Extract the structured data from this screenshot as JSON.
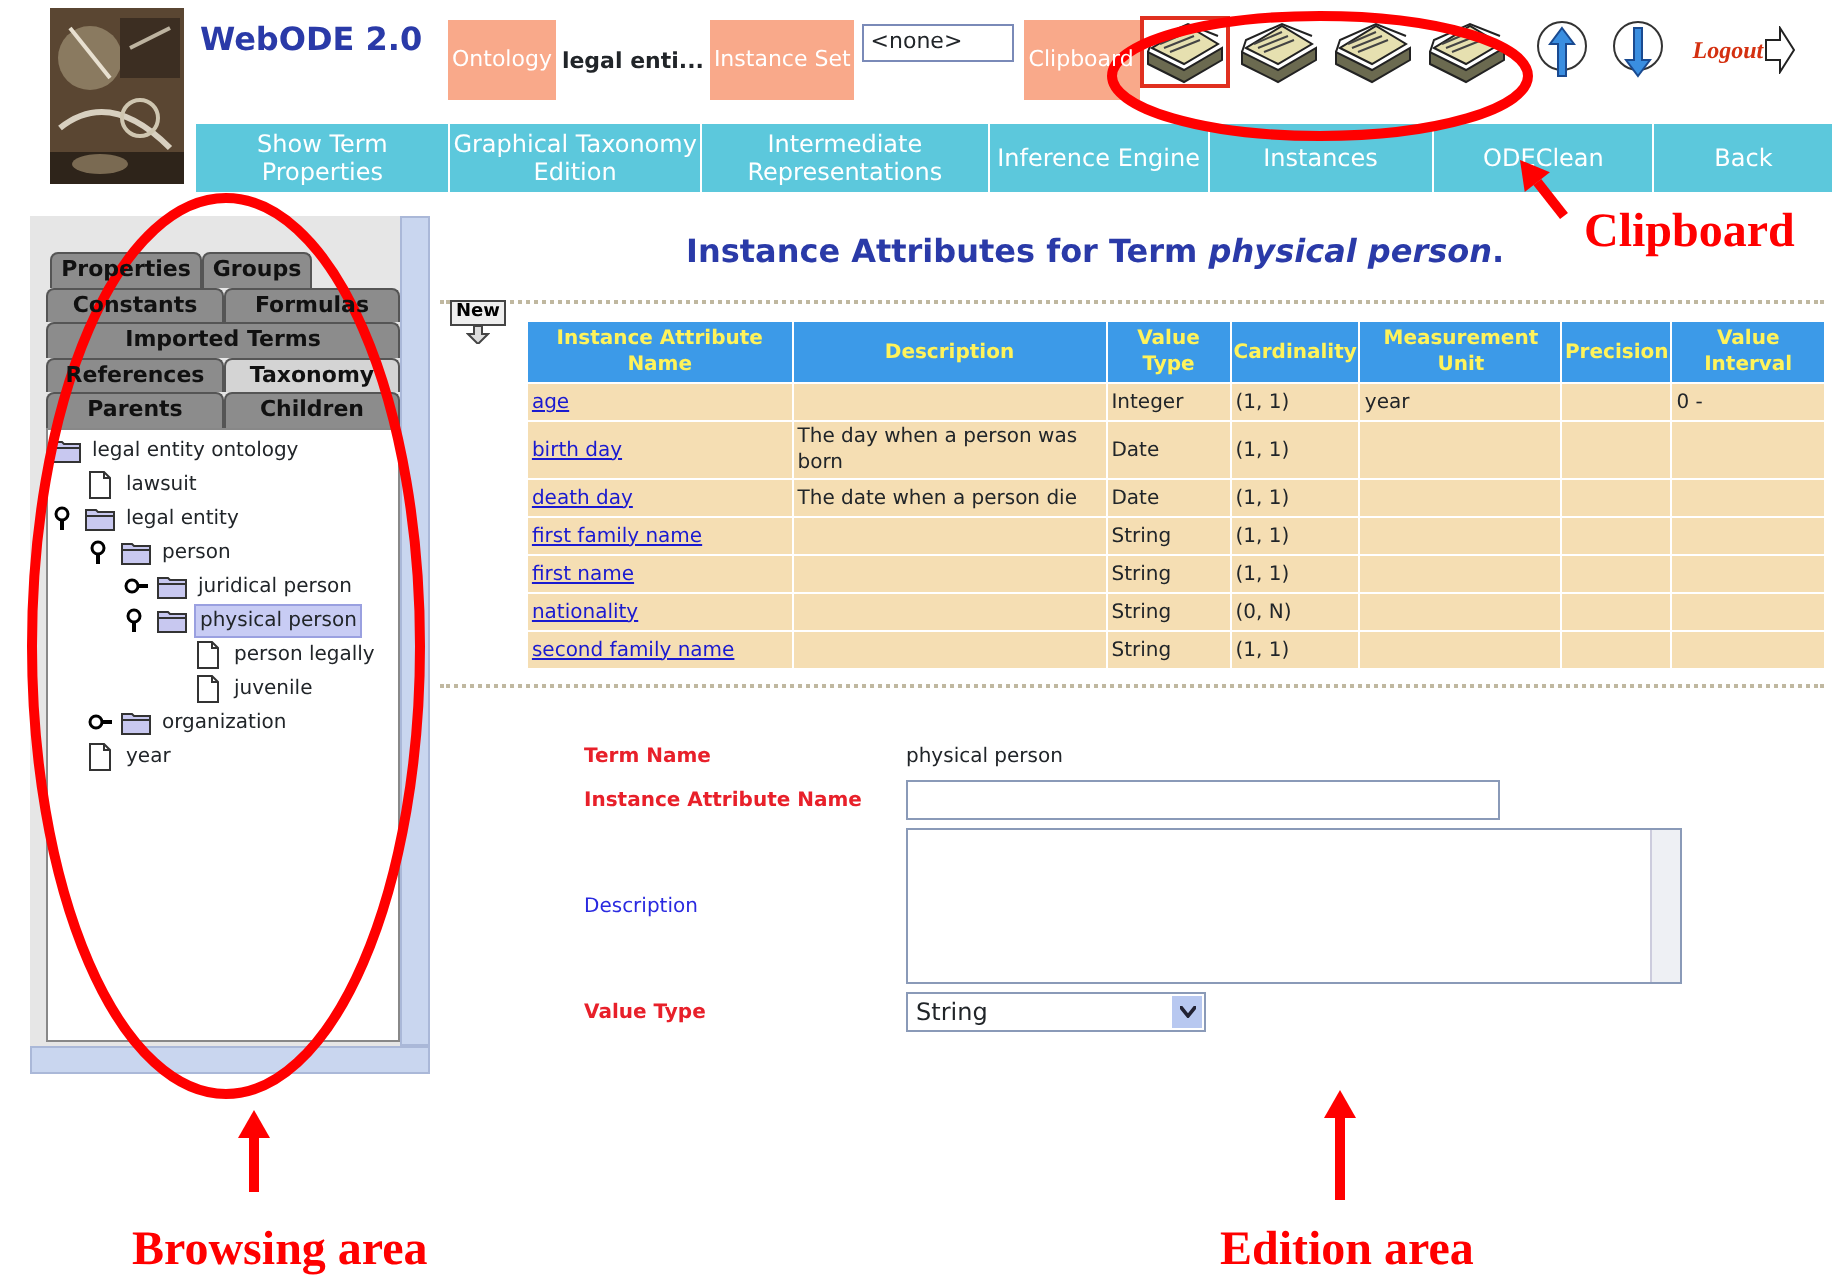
{
  "app": {
    "title": "WebODE 2.0"
  },
  "toolbar": {
    "ontology_label": "Ontology",
    "ontology_value": "legal enti...",
    "instance_set_label": "Instance Set",
    "instance_set_value": "<none>",
    "clipboard_label": "Clipboard",
    "logout": "Logout",
    "clipboard_slots": [
      {
        "selected": true
      },
      {
        "selected": false
      },
      {
        "selected": false
      },
      {
        "selected": false
      }
    ]
  },
  "nav": [
    {
      "label": "Show Term Properties"
    },
    {
      "label": "Graphical Taxonomy Edition"
    },
    {
      "label": "Intermediate Representations"
    },
    {
      "label": "Inference Engine"
    },
    {
      "label": "Instances"
    },
    {
      "label": "ODEClean"
    },
    {
      "label": "Back"
    }
  ],
  "browser": {
    "tab_rows": [
      [
        {
          "label": "Properties",
          "selected": false
        },
        {
          "label": "Groups",
          "selected": false
        }
      ],
      [
        {
          "label": "Constants",
          "selected": false
        },
        {
          "label": "Formulas",
          "selected": false
        }
      ],
      [
        {
          "label": "Imported Terms",
          "selected": false
        }
      ],
      [
        {
          "label": "References",
          "selected": false
        },
        {
          "label": "Taxonomy",
          "selected": true
        }
      ],
      [
        {
          "label": "Parents",
          "selected": false
        },
        {
          "label": "Children",
          "selected": false
        }
      ]
    ],
    "tree": [
      {
        "label": "legal entity ontology",
        "kind": "folder",
        "selected": false,
        "children": [
          {
            "label": "lawsuit",
            "kind": "doc",
            "selected": false
          },
          {
            "label": "legal entity",
            "kind": "folder",
            "expanded": true,
            "selected": false,
            "children": [
              {
                "label": "person",
                "kind": "folder",
                "expanded": true,
                "selected": false,
                "children": [
                  {
                    "label": "juridical person",
                    "kind": "folder",
                    "expanded": false,
                    "selected": false
                  },
                  {
                    "label": "physical person",
                    "kind": "folder",
                    "expanded": true,
                    "selected": true,
                    "children": [
                      {
                        "label": "person legally",
                        "kind": "doc",
                        "selected": false
                      },
                      {
                        "label": "juvenile",
                        "kind": "doc",
                        "selected": false
                      }
                    ]
                  }
                ]
              },
              {
                "label": "organization",
                "kind": "folder",
                "expanded": false,
                "selected": false
              }
            ]
          },
          {
            "label": "year",
            "kind": "doc",
            "selected": false
          }
        ]
      }
    ]
  },
  "heading": "Instance Attributes for Term *physical person*.",
  "new_button": "New",
  "table": {
    "columns": [
      "Instance Attribute Name",
      "Description",
      "Value Type",
      "Cardinality",
      "Measurement Unit",
      "Precision",
      "Value Interval"
    ],
    "rows": [
      [
        "age",
        "",
        "Integer",
        "(1, 1)",
        "year",
        "",
        "0 -"
      ],
      [
        "birth day",
        "The day when a person was born",
        "Date",
        "(1, 1)",
        "",
        "",
        ""
      ],
      [
        "death day",
        "The date when a person die",
        "Date",
        "(1, 1)",
        "",
        "",
        ""
      ],
      [
        "first family name",
        "",
        "String",
        "(1, 1)",
        "",
        "",
        ""
      ],
      [
        "first name",
        "",
        "String",
        "(1, 1)",
        "",
        "",
        ""
      ],
      [
        "nationality",
        "",
        "String",
        "(0, N)",
        "",
        "",
        ""
      ],
      [
        "second family name",
        "",
        "String",
        "(1, 1)",
        "",
        "",
        ""
      ]
    ]
  },
  "form": {
    "fields": [
      {
        "label": "Term Name",
        "kind": "text",
        "required": true,
        "value": "physical person"
      },
      {
        "label": "Instance Attribute Name",
        "kind": "input",
        "required": true
      },
      {
        "label": "Description",
        "kind": "textarea",
        "required": false
      },
      {
        "label": "Value Type",
        "kind": "select",
        "required": true,
        "value": "String"
      }
    ]
  },
  "annotations": [
    {
      "label": "Clipboard"
    },
    {
      "label": "Browsing area"
    },
    {
      "label": "Edition area"
    }
  ]
}
